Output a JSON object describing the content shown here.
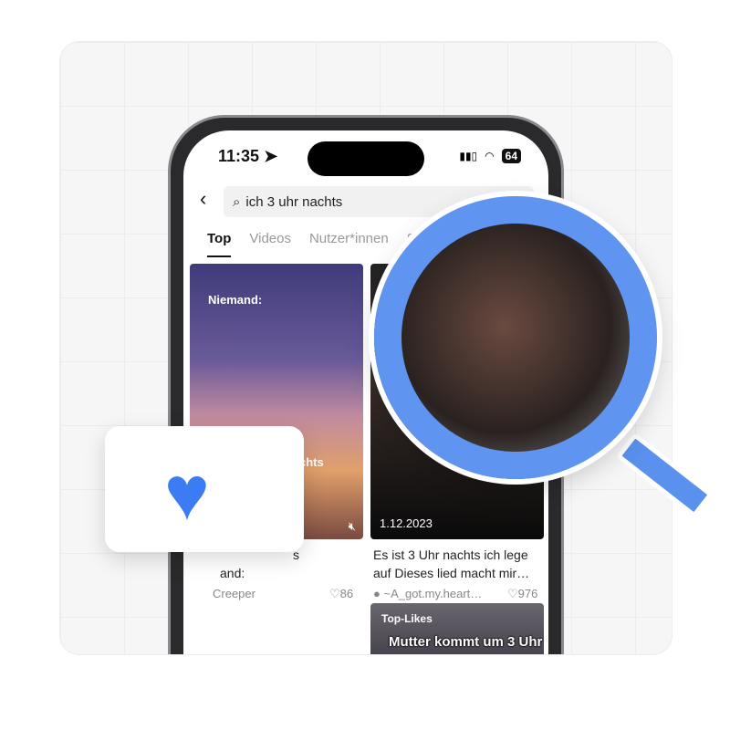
{
  "status": {
    "time": "11:35",
    "battery": "64"
  },
  "search": {
    "query": "ich 3 uhr nachts"
  },
  "tabs": [
    {
      "label": "Top",
      "active": true
    },
    {
      "label": "Videos"
    },
    {
      "label": "Nutzer*innen"
    },
    {
      "label": "S"
    }
  ],
  "cards": [
    {
      "overlay_top": "Niemand:",
      "overlay_mid": "chts",
      "title_lines": [
        "s",
        "and:"
      ],
      "author": "Creeper",
      "likes": "86"
    },
    {
      "date": "1.12.2023",
      "title_lines": [
        "Es ist 3 Uhr nachts ich lege",
        "auf Dieses lied macht mir…"
      ],
      "author": "~A_got.my.heart…",
      "likes": "976"
    },
    {
      "badge": "Top-Likes",
      "caption": "Mutter kommt um 3 Uhr"
    }
  ],
  "colors": {
    "accent": "#5f95f0",
    "heart": "#3b7cf4"
  }
}
